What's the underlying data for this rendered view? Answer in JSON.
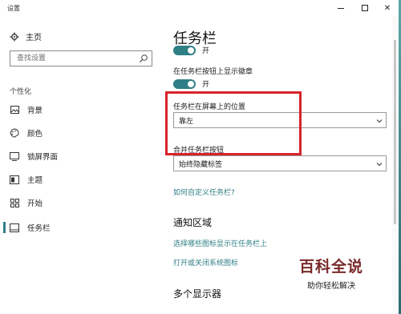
{
  "window": {
    "title": "设置"
  },
  "sidebar": {
    "home_label": "主页",
    "search_placeholder": "查找设置",
    "section_label": "个性化",
    "items": [
      {
        "label": "背景",
        "icon": "image-icon"
      },
      {
        "label": "颜色",
        "icon": "palette-icon"
      },
      {
        "label": "锁屏界面",
        "icon": "lock-screen-icon"
      },
      {
        "label": "主题",
        "icon": "theme-icon"
      },
      {
        "label": "开始",
        "icon": "start-icon"
      },
      {
        "label": "任务栏",
        "icon": "taskbar-icon",
        "active": true
      }
    ]
  },
  "main": {
    "title": "任务栏",
    "toggle1_state": "开",
    "badge_label": "在任务栏按钮上显示徽章",
    "toggle2_state": "开",
    "position_label": "任务栏在屏幕上的位置",
    "position_value": "靠左",
    "combine_label": "合并任务栏按钮",
    "combine_value": "始终隐藏标签",
    "customize_link": "如何自定义任务栏?",
    "notification_heading": "通知区域",
    "select_icons_link": "选择哪些图标显示在任务栏上",
    "system_icons_link": "打开或关闭系统图标",
    "multi_display_heading": "多个显示器"
  },
  "watermark": {
    "title": "百科全说",
    "subtitle": "助你轻松解决"
  },
  "colors": {
    "accent": "#2f7f86",
    "highlight": "#d8232a"
  }
}
